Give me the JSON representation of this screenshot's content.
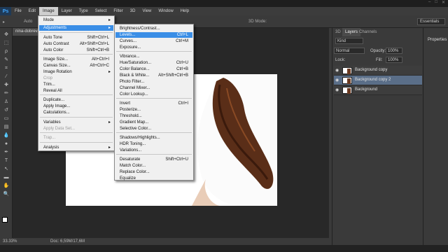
{
  "app": {
    "logo": "Ps"
  },
  "menubar": {
    "items": [
      "File",
      "Edit",
      "Image",
      "Layer",
      "Type",
      "Select",
      "Filter",
      "3D",
      "View",
      "Window",
      "Help"
    ],
    "active": "Image"
  },
  "options": {
    "auto_label": "Auto",
    "mode_3d": "3D Mode:",
    "workspace": "Essentials"
  },
  "document": {
    "tab_title": "nina-dobrev...",
    "zoom": "33.33%",
    "doc_info": "Doc: 6,59M/17,6M"
  },
  "image_menu": {
    "items": [
      {
        "label": "Mode",
        "arrow": "▸"
      },
      {
        "label": "Adjustments",
        "arrow": "▸",
        "highlight": true
      },
      {
        "label": "Auto Tone",
        "shortcut": "Shift+Ctrl+L"
      },
      {
        "label": "Auto Contrast",
        "shortcut": "Alt+Shift+Ctrl+L"
      },
      {
        "label": "Auto Color",
        "shortcut": "Shift+Ctrl+B"
      },
      {
        "label": "Image Size...",
        "shortcut": "Alt+Ctrl+I"
      },
      {
        "label": "Canvas Size...",
        "shortcut": "Alt+Ctrl+C"
      },
      {
        "label": "Image Rotation",
        "arrow": "▸"
      },
      {
        "label": "Crop",
        "disabled": true
      },
      {
        "label": "Trim..."
      },
      {
        "label": "Reveal All"
      },
      {
        "label": "Duplicate..."
      },
      {
        "label": "Apply Image..."
      },
      {
        "label": "Calculations..."
      },
      {
        "label": "Variables",
        "arrow": "▸"
      },
      {
        "label": "Apply Data Set...",
        "disabled": true
      },
      {
        "label": "Trap...",
        "disabled": true
      },
      {
        "label": "Analysis",
        "arrow": "▸"
      }
    ]
  },
  "adjustments_menu": {
    "items": [
      {
        "label": "Brightness/Contrast..."
      },
      {
        "label": "Levels...",
        "shortcut": "Ctrl+L",
        "highlight": true
      },
      {
        "label": "Curves...",
        "shortcut": "Ctrl+M"
      },
      {
        "label": "Exposure..."
      },
      {
        "label": "Vibrance..."
      },
      {
        "label": "Hue/Saturation...",
        "shortcut": "Ctrl+U"
      },
      {
        "label": "Color Balance...",
        "shortcut": "Ctrl+B"
      },
      {
        "label": "Black & White...",
        "shortcut": "Alt+Shift+Ctrl+B"
      },
      {
        "label": "Photo Filter..."
      },
      {
        "label": "Channel Mixer..."
      },
      {
        "label": "Color Lookup..."
      },
      {
        "label": "Invert",
        "shortcut": "Ctrl+I"
      },
      {
        "label": "Posterize..."
      },
      {
        "label": "Threshold..."
      },
      {
        "label": "Gradient Map..."
      },
      {
        "label": "Selective Color..."
      },
      {
        "label": "Shadows/Highlights..."
      },
      {
        "label": "HDR Toning..."
      },
      {
        "label": "Variations..."
      },
      {
        "label": "Desaturate",
        "shortcut": "Shift+Ctrl+U"
      },
      {
        "label": "Match Color..."
      },
      {
        "label": "Replace Color..."
      },
      {
        "label": "Equalize"
      }
    ]
  },
  "panel": {
    "tabs": [
      "3D",
      "Layers",
      "Channels"
    ],
    "kind": "Kind",
    "blend_mode": "Normal",
    "opacity_label": "Opacity:",
    "opacity_value": "100%",
    "lock_label": "Lock:",
    "fill_label": "Fill:",
    "fill_value": "100%",
    "layers": [
      {
        "name": "Background copy",
        "selected": false
      },
      {
        "name": "Background copy 2",
        "selected": true
      },
      {
        "name": "Background",
        "selected": false
      }
    ]
  },
  "properties": {
    "label": "Properties"
  }
}
